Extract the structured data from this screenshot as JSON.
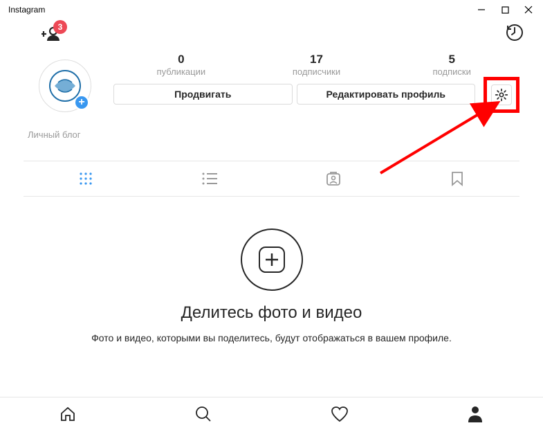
{
  "window": {
    "title": "Instagram"
  },
  "topbar": {
    "badge_count": "3"
  },
  "stats": {
    "posts": {
      "value": "0",
      "label": "публикации"
    },
    "followers": {
      "value": "17",
      "label": "подписчики"
    },
    "following": {
      "value": "5",
      "label": "подписки"
    }
  },
  "buttons": {
    "promote": "Продвигать",
    "edit_profile": "Редактировать профиль"
  },
  "bio": "Личный блог",
  "empty": {
    "title": "Делитесь фото и видео",
    "subtitle": "Фото и видео, которыми вы поделитесь, будут отображаться в вашем профиле."
  }
}
